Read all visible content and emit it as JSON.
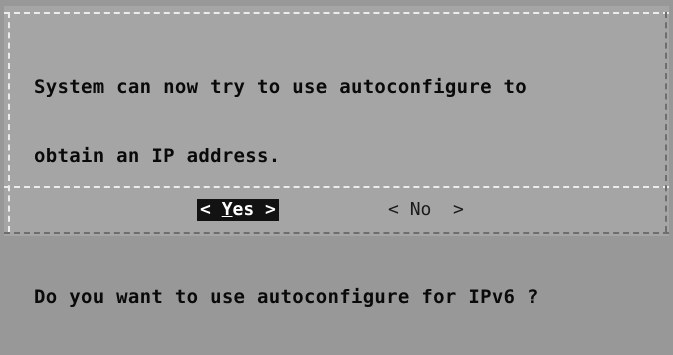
{
  "dialog": {
    "message_lines": [
      "System can now try to use autoconfigure to",
      "obtain an IP address.",
      "Do you want to use autoconfigure for IPv6 ?"
    ],
    "buttons": {
      "yes": {
        "open": "< ",
        "hotkey": "Y",
        "rest": "es",
        "close": " >"
      },
      "no": {
        "open": "< ",
        "hotkey": "N",
        "rest": "o",
        "close": "  >"
      }
    },
    "selected_button": "yes"
  }
}
